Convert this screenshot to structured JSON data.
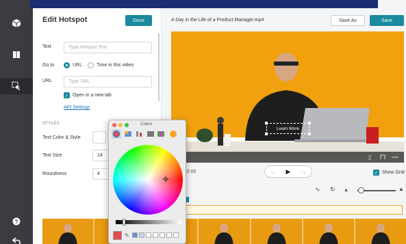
{
  "rail": {
    "items": [
      "cube-icon",
      "book-icon",
      "cursor-icon",
      "help-icon",
      "back-icon"
    ]
  },
  "panel": {
    "title": "Edit Hotspot",
    "done_label": "Done",
    "text_label": "Text",
    "text_placeholder": "Type Hotspot Text",
    "goto_label": "Go to",
    "goto_options": [
      "URL",
      "Time in this video"
    ],
    "url_label": "URL",
    "url_placeholder": "Type URL",
    "open_new_tab_label": "Open in a new tab",
    "api_settings_label": "API Settings",
    "styles_heading": "STYLES",
    "text_color_label": "Text Color & Style",
    "text_size_label": "Text Size",
    "text_size_value": "14",
    "roundness_label": "Roundness",
    "roundness_value": "4"
  },
  "editor": {
    "video_title": "A Day in the Life of a Product Manager.mp4",
    "save_as_label": "Save As",
    "save_label": "Save",
    "hotspot_text": "Learn More",
    "time_label": "/ 02:00",
    "show_grid_label": "Show Grid"
  },
  "color_picker": {
    "title": "Colors"
  },
  "colors": {
    "accent": "#1a8a9e",
    "video_bg": "#f1a10d",
    "rail_bg": "#3b3c3f",
    "banner": "#1b2d73"
  }
}
